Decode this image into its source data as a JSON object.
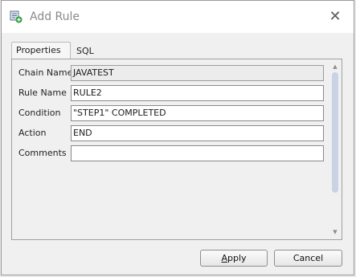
{
  "window": {
    "title": "Add Rule",
    "close_glyph": "✕"
  },
  "tabs": [
    {
      "label": "Properties",
      "active": true
    },
    {
      "label": "SQL",
      "active": false
    }
  ],
  "form": {
    "chain_name": {
      "label": "Chain Name",
      "value": "JAVATEST"
    },
    "rule_name": {
      "label": "Rule Name",
      "value": "RULE2"
    },
    "condition": {
      "label": "Condition",
      "value": "\"STEP1\" COMPLETED"
    },
    "action": {
      "label": "Action",
      "value": "END"
    },
    "comments": {
      "label": "Comments",
      "value": ""
    }
  },
  "buttons": {
    "apply_first": "A",
    "apply_rest": "pply",
    "cancel": "Cancel"
  },
  "icons": {
    "title_icon": "add-rule-icon",
    "close": "close-icon",
    "scroll_up": "scroll-up-arrow",
    "scroll_down": "scroll-down-arrow"
  },
  "colors": {
    "accent_icon": "#2e7d32",
    "scroll_thumb": "#c9d3e3"
  }
}
